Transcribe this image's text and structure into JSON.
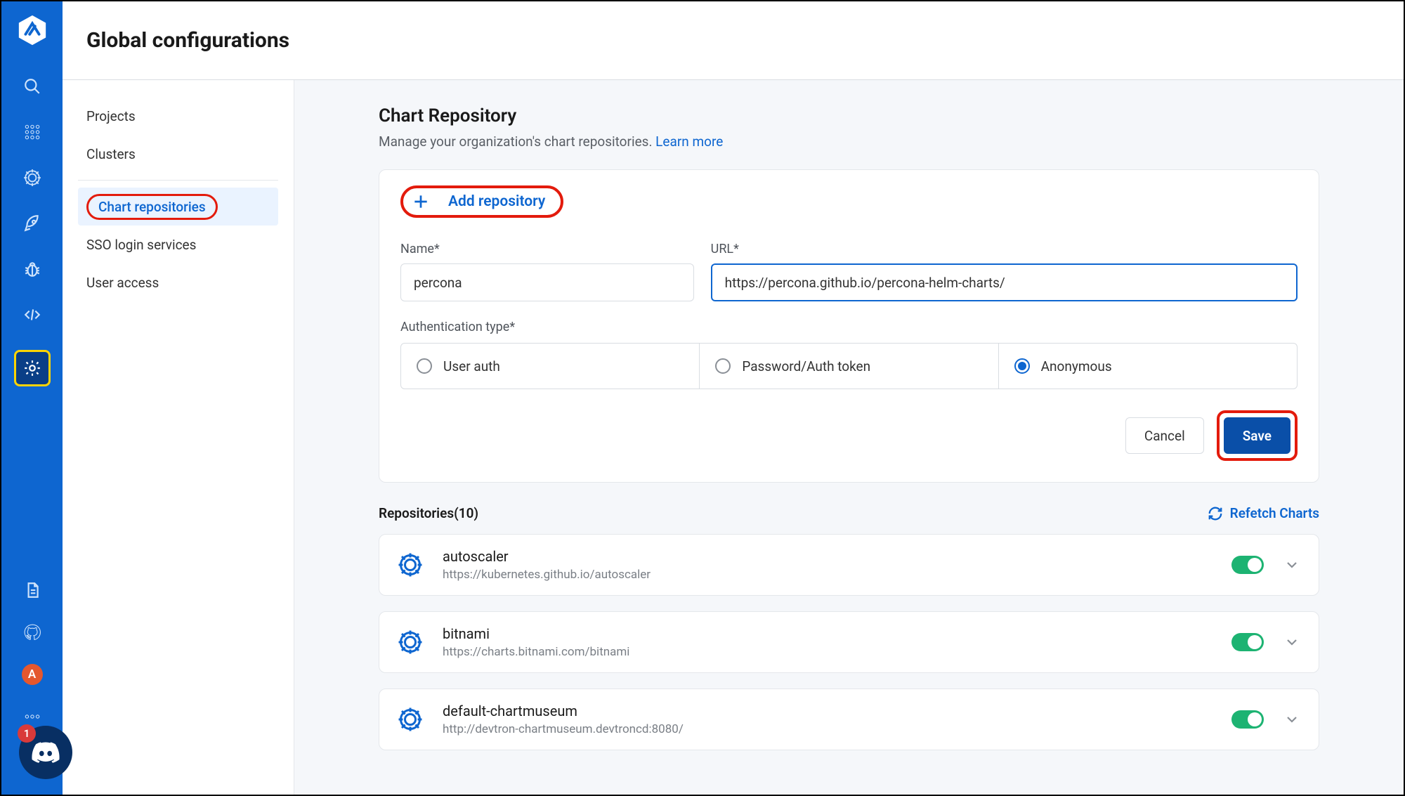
{
  "header": {
    "title": "Global configurations"
  },
  "subnav": {
    "items": [
      {
        "label": "Projects"
      },
      {
        "label": "Clusters"
      }
    ],
    "items2": [
      {
        "label": "Chart repositories",
        "active": true
      },
      {
        "label": "SSO login services"
      },
      {
        "label": "User access"
      }
    ]
  },
  "callout": {
    "label": "Global Configurations"
  },
  "rail": {
    "avatar_letter": "A"
  },
  "discord": {
    "badge": "1"
  },
  "page": {
    "title": "Chart Repository",
    "subtitle_text": "Manage your organization's chart repositories. ",
    "learn_more": "Learn more"
  },
  "add_repo": {
    "button": "Add repository",
    "name_label": "Name*",
    "url_label": "URL*",
    "name_value": "percona",
    "url_value": "https://percona.github.io/percona-helm-charts/",
    "auth_label": "Authentication type*",
    "auth_options": [
      {
        "label": "User auth",
        "selected": false
      },
      {
        "label": "Password/Auth token",
        "selected": false
      },
      {
        "label": "Anonymous",
        "selected": true
      }
    ],
    "cancel": "Cancel",
    "save": "Save"
  },
  "repos": {
    "heading": "Repositories(10)",
    "refetch": "Refetch Charts",
    "items": [
      {
        "name": "autoscaler",
        "url": "https://kubernetes.github.io/autoscaler",
        "enabled": true
      },
      {
        "name": "bitnami",
        "url": "https://charts.bitnami.com/bitnami",
        "enabled": true
      },
      {
        "name": "default-chartmuseum",
        "url": "http://devtron-chartmuseum.devtroncd:8080/",
        "enabled": true
      }
    ]
  }
}
